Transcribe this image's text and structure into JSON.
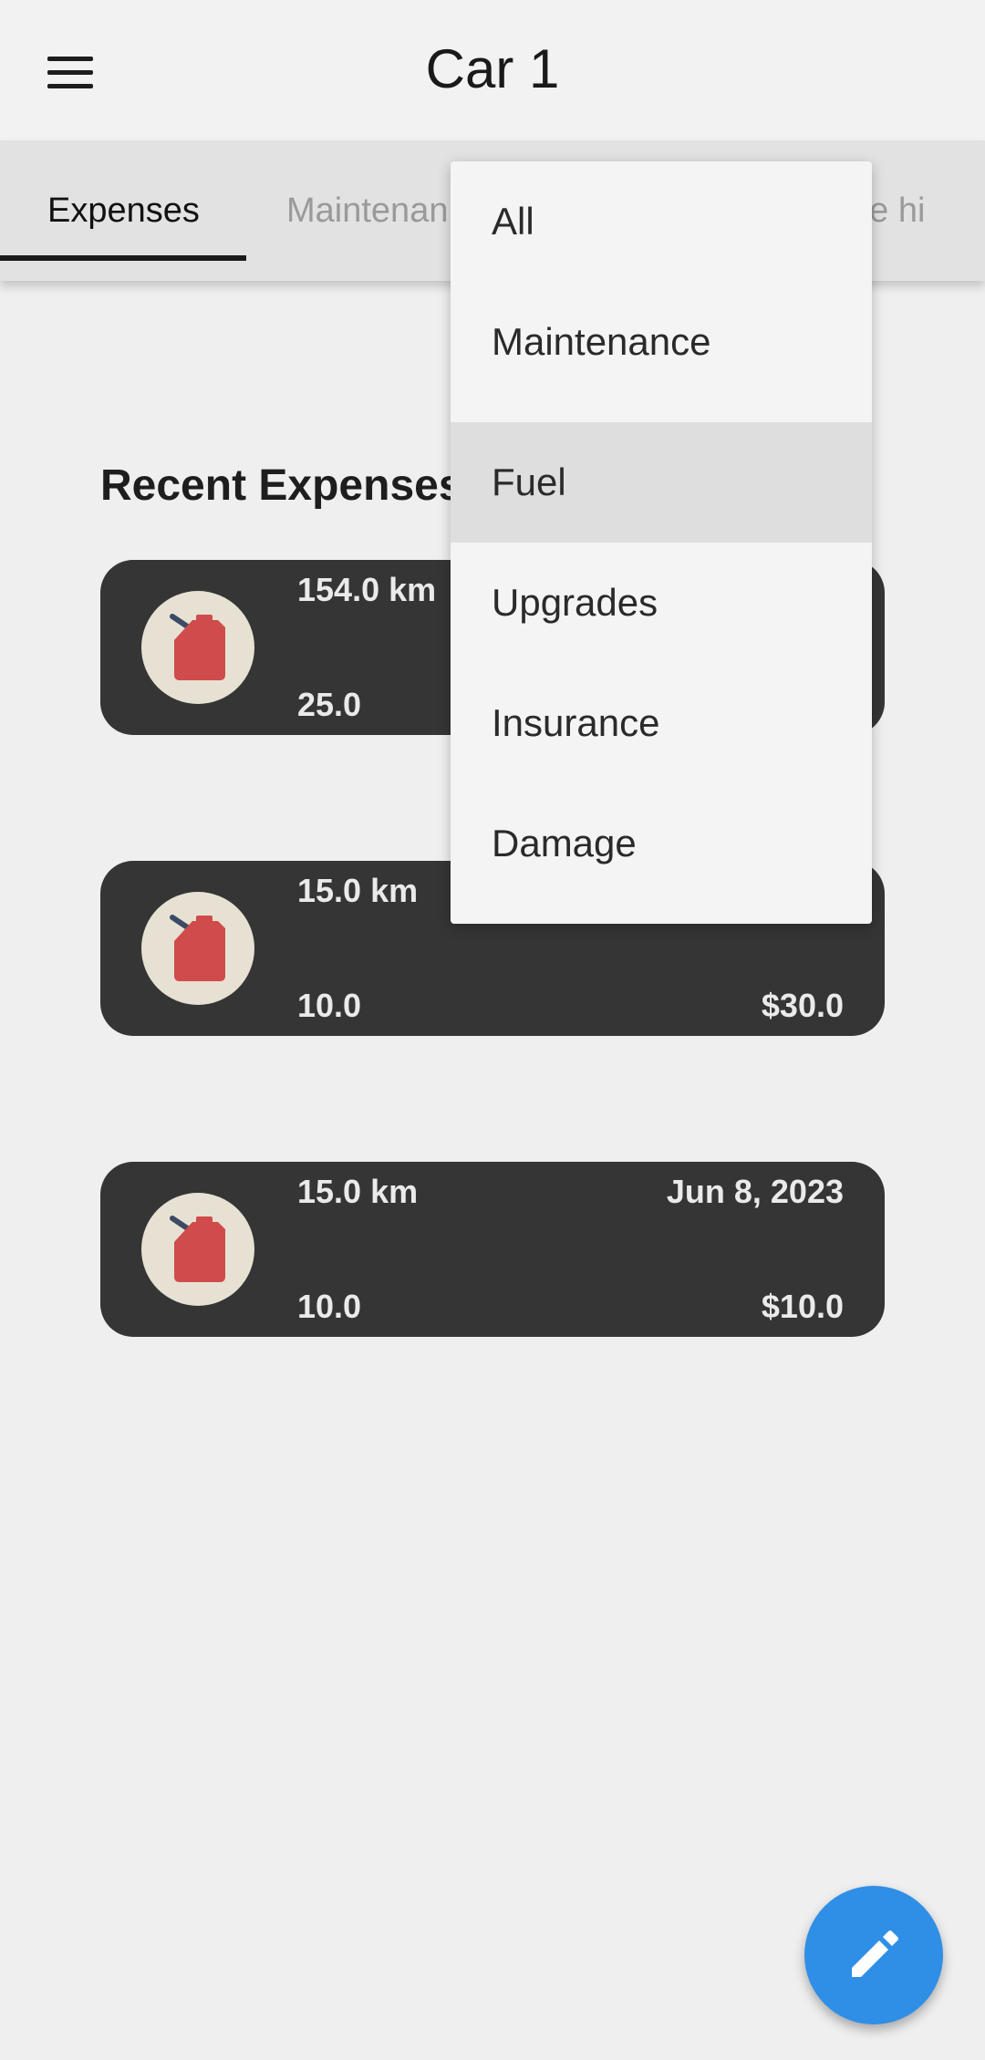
{
  "app": {
    "title": "Car 1"
  },
  "tabs": [
    {
      "label": "Expenses",
      "active": true
    },
    {
      "label": "Maintenan",
      "active": false
    },
    {
      "label": "ge hi",
      "active": false
    }
  ],
  "section": {
    "title": "Recent Expenses"
  },
  "expenses": [
    {
      "distance": "154.0 km",
      "date": "",
      "quantity": "25.0",
      "price": "",
      "icon": "fuel-can-icon"
    },
    {
      "distance": "15.0 km",
      "date": "",
      "quantity": "10.0",
      "price": "$30.0",
      "icon": "fuel-can-icon"
    },
    {
      "distance": "15.0 km",
      "date": "Jun 8, 2023",
      "quantity": "10.0",
      "price": "$10.0",
      "icon": "fuel-can-icon"
    }
  ],
  "filter_menu": {
    "options": [
      "All",
      "Maintenance",
      "Fuel",
      "Upgrades",
      "Insurance",
      "Damage"
    ],
    "selected": "Fuel"
  },
  "fab": {
    "icon": "pencil-icon"
  },
  "colors": {
    "card_bg": "#353535",
    "fab": "#2f8fe6",
    "fuel_can": "#d04b4b",
    "avatar_bg": "#e6e1d2"
  }
}
